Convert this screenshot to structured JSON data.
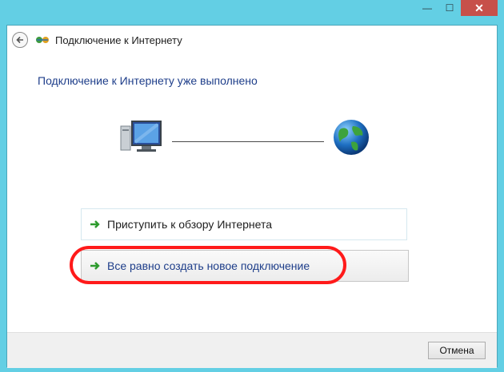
{
  "window": {
    "controls": {
      "minimize": "—",
      "maximize": "☐",
      "close": "✕"
    }
  },
  "nav": {
    "title": "Подключение к Интернету",
    "back_icon": "back-arrow-icon",
    "app_icon": "network-wizard-icon"
  },
  "main": {
    "heading": "Подключение к Интернету уже выполнено",
    "left_icon": "computer-icon",
    "right_icon": "globe-icon",
    "options": [
      {
        "label": "Приступить к обзору Интернета",
        "icon": "green-arrow-icon"
      },
      {
        "label": "Все равно создать новое подключение",
        "icon": "green-arrow-icon"
      }
    ],
    "annotation_color": "#ff1a1a"
  },
  "footer": {
    "cancel_label": "Отмена"
  }
}
